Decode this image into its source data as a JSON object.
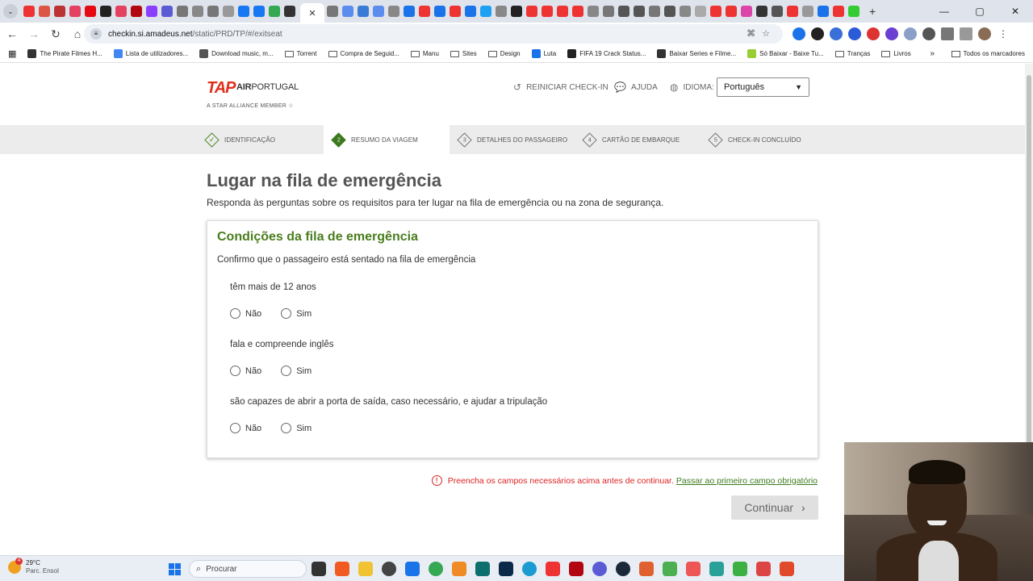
{
  "browser": {
    "url_host": "checkin.si.amadeus.net",
    "url_path": "/static/PRD/TP/#/exitseat",
    "tab_close": "✕",
    "new_tab": "+",
    "window_controls": [
      "—",
      "▢",
      "✕"
    ],
    "bookmarks": [
      {
        "label": "The Pirate Filmes H...",
        "icon": "pirate-icon",
        "color": "#333333"
      },
      {
        "label": "Lista de utilizadores...",
        "icon": "google-icon",
        "color": "#4285f4"
      },
      {
        "label": "Download music, m...",
        "icon": "music-icon",
        "color": "#555555"
      },
      {
        "label": "Torrent",
        "icon": "folder-icon"
      },
      {
        "label": "Compra de Seguid...",
        "icon": "folder-icon"
      },
      {
        "label": "Manu",
        "icon": "folder-icon"
      },
      {
        "label": "Sites",
        "icon": "folder-icon"
      },
      {
        "label": "Design",
        "icon": "folder-icon"
      },
      {
        "label": "Luta",
        "icon": "luta-icon",
        "color": "#1a73e8"
      },
      {
        "label": "FIFA 19 Crack Status...",
        "icon": "fifa-icon",
        "color": "#222222"
      },
      {
        "label": "Baixar Series e Filme...",
        "icon": "globe-icon",
        "color": "#333333"
      },
      {
        "label": "Só Baixar - Baixe Tu...",
        "icon": "sobaixar-icon",
        "color": "#9acd32"
      },
      {
        "label": "Tranças",
        "icon": "folder-icon"
      },
      {
        "label": "Livros",
        "icon": "folder-icon"
      }
    ],
    "bookmarks_more": "»",
    "all_bookmarks": "Todos os marcadores"
  },
  "header": {
    "logo_mark": "TAP",
    "brand_bold": "AIR",
    "brand_rest": "PORTUGAL",
    "alliance": "A STAR ALLIANCE MEMBER",
    "restart": "REINICIAR CHECK-IN",
    "help": "AJUDA",
    "language_label": "IDIOMA:",
    "language_value": "Português"
  },
  "steps": [
    {
      "num": "✓",
      "label": "IDENTIFICAÇÃO",
      "state": "done"
    },
    {
      "num": "2",
      "label": "RESUMO DA VIAGEM",
      "state": "current"
    },
    {
      "num": "3",
      "label": "DETALHES DO PASSAGEIRO",
      "state": "todo"
    },
    {
      "num": "4",
      "label": "CARTÃO DE EMBARQUE",
      "state": "todo"
    },
    {
      "num": "5",
      "label": "CHECK-IN CONCLUÍDO",
      "state": "todo"
    }
  ],
  "main": {
    "title": "Lugar na fila de emergência",
    "subtitle": "Responda às perguntas sobre os requisitos para ter lugar na fila de emergência ou na zona de segurança.",
    "card_title": "Condições da fila de emergência",
    "card_intro": "Confirmo que o passageiro está sentado na fila de emergência",
    "questions": [
      {
        "text": "têm mais de 12 anos",
        "no": "Não",
        "yes": "Sim"
      },
      {
        "text": "fala e compreende inglês",
        "no": "Não",
        "yes": "Sim"
      },
      {
        "text": "são capazes de abrir a porta de saída, caso necessário, e ajudar a tripulação",
        "no": "Não",
        "yes": "Sim"
      }
    ],
    "error_message": "Preencha os campos necessários acima antes de continuar.",
    "error_link": "Passar ao primeiro campo obrigatório",
    "continue": "Continuar"
  },
  "taskbar": {
    "weather_badge": "4",
    "temperature": "29°C",
    "condition": "Parc. Ensol",
    "search_placeholder": "Procurar"
  },
  "colors": {
    "brand_green": "#4a7d1e",
    "brand_red": "#e0301e",
    "error_red": "#d22222"
  }
}
